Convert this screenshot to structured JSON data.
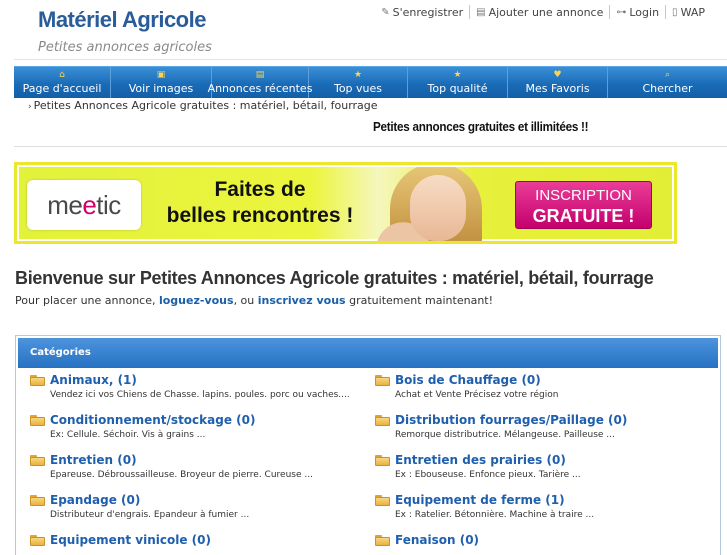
{
  "header": {
    "logo_title": "Matériel Agricole",
    "logo_subtitle": "Petites annonces agricoles",
    "links": [
      {
        "label": "S'enregistrer",
        "icon": "pencil-icon"
      },
      {
        "label": "Ajouter une annonce",
        "icon": "add-listing-icon"
      },
      {
        "label": "Login",
        "icon": "key-icon"
      },
      {
        "label": "WAP",
        "icon": "mobile-icon"
      }
    ]
  },
  "nav": {
    "items": [
      {
        "label": "Page d'accueil",
        "icon": "home-icon"
      },
      {
        "label": "Voir images",
        "icon": "images-icon"
      },
      {
        "label": "Annonces récentes",
        "icon": "recent-icon"
      },
      {
        "label": "Top vues",
        "icon": "star-icon"
      },
      {
        "label": "Top qualité",
        "icon": "star-icon"
      },
      {
        "label": "Mes Favoris",
        "icon": "favorites-icon"
      },
      {
        "label": "Chercher",
        "icon": "search-icon"
      }
    ]
  },
  "breadcrumb": {
    "text": "Petites Annonces Agricole gratuites : matériel, bétail, fourrage"
  },
  "promo_line": "Petites annonces gratuites et illimitées !!",
  "banner": {
    "logo_pre": "me",
    "logo_accent": "e",
    "logo_post": "tic",
    "text_line1": "Faites de",
    "text_line2": "belles rencontres !",
    "cta_line1": "INSCRIPTION",
    "cta_line2": "GRATUITE !"
  },
  "main": {
    "title": "Bienvenue sur Petites Annonces Agricole gratuites : matériel, bétail, fourrage",
    "intro_before": "Pour placer une annonce, ",
    "login_link": "loguez-vous",
    "intro_middle": ", ou ",
    "register_link": "inscrivez vous",
    "intro_after": " gratuitement maintenant!"
  },
  "categories": {
    "header": "Catégories",
    "items": [
      {
        "name": "Animaux, (1)",
        "desc": "Vendez ici vos Chiens de Chasse. lapins. poules. porc ou vaches...."
      },
      {
        "name": "Bois de Chauffage (0)",
        "desc": "Achat et Vente Précisez votre région"
      },
      {
        "name": "Conditionnement/stockage (0)",
        "desc": "Ex: Cellule. Séchoir. Vis à grains ..."
      },
      {
        "name": "Distribution fourrages/Paillage (0)",
        "desc": "Remorque distributrice. Mélangeuse. Pailleuse ..."
      },
      {
        "name": "Entretien (0)",
        "desc": "Epareuse. Débroussailleuse. Broyeur de pierre. Cureuse ..."
      },
      {
        "name": "Entretien des prairies (0)",
        "desc": "Ex : Ebouseuse. Enfonce pieux. Tarière ..."
      },
      {
        "name": "Epandage (0)",
        "desc": "Distributeur d'engrais. Epandeur à fumier ..."
      },
      {
        "name": "Equipement de ferme (1)",
        "desc": "Ex : Ratelier. Bétonnière. Machine à traire ..."
      },
      {
        "name": "Equipement vinicole (0)",
        "desc": ""
      },
      {
        "name": "Fenaison (0)",
        "desc": ""
      }
    ]
  }
}
